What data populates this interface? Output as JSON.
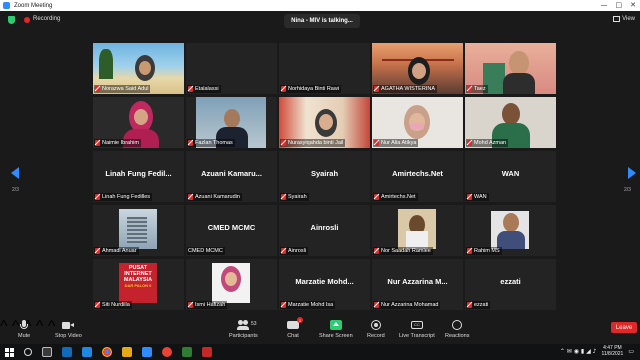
{
  "window": {
    "title": "Zoom Meeting",
    "controls": [
      "—",
      "□",
      "✕"
    ]
  },
  "topbar": {
    "recording_label": "Recording",
    "talking": "Nina - MIV is talking...",
    "view_label": "View"
  },
  "pagination": {
    "left": "2/3",
    "right": "2/3"
  },
  "tiles": [
    {
      "name": "Norazwa Said Adul",
      "big": ""
    },
    {
      "name": "Etalalassi",
      "big": ""
    },
    {
      "name": "Norhidaya Binti Rawi",
      "big": ""
    },
    {
      "name": "AGATHA WISTERINA",
      "big": ""
    },
    {
      "name": "Taez",
      "big": ""
    },
    {
      "name": "Naimie Ibrahim",
      "big": ""
    },
    {
      "name": "Fazlan Thomas",
      "big": ""
    },
    {
      "name": "Nurasyiqahda binti Jail",
      "big": ""
    },
    {
      "name": "Nur Alia Atikya",
      "big": ""
    },
    {
      "name": "Mohd Azman",
      "big": ""
    },
    {
      "name": "Linah Fung Fedilles",
      "big": "Linah Fung Fedil..."
    },
    {
      "name": "Azuani Kamarudin",
      "big": "Azuani Kamaru..."
    },
    {
      "name": "Syairah",
      "big": "Syairah"
    },
    {
      "name": "Amirtechs.Net",
      "big": "Amirtechs.Net"
    },
    {
      "name": "WAN",
      "big": "WAN"
    },
    {
      "name": "Ahmadi Anuar",
      "big": ""
    },
    {
      "name": "CMED MCMC",
      "big": "CMED MCMC"
    },
    {
      "name": "Ainrosli",
      "big": "Ainrosli"
    },
    {
      "name": "Nor Saadah Ramlee",
      "big": ""
    },
    {
      "name": "Rahim MS",
      "big": ""
    },
    {
      "name": "Siti Nurdiila",
      "big": ""
    },
    {
      "name": "Ismi Hafizah",
      "big": ""
    },
    {
      "name": "Marzatie Mohd Isa",
      "big": "Marzatie Mohd..."
    },
    {
      "name": "Nur Azzarina Mohamad",
      "big": "Nur Azzarina M..."
    },
    {
      "name": "ezzati",
      "big": "ezzati"
    }
  ],
  "poster_text": [
    "PUSAT",
    "INTERNET",
    "MALAYSIA",
    "DAR PALON 0"
  ],
  "controls": {
    "mute": "Mute",
    "stop_video": "Stop Video",
    "participants": "Participants",
    "participants_count": "53",
    "chat": "Chat",
    "chat_badge": "1",
    "share_screen": "Share Screen",
    "record": "Record",
    "live_transcript": "Live Transcript",
    "reactions": "Reactions",
    "leave": "Leave"
  },
  "taskbar": {
    "time": "4:47 PM",
    "date": "11/8/2021"
  },
  "colors": {
    "accent": "#2d8cff",
    "mic_muted": "#e02828",
    "share_green": "#2ecc71",
    "tile_bg": "#232323"
  }
}
